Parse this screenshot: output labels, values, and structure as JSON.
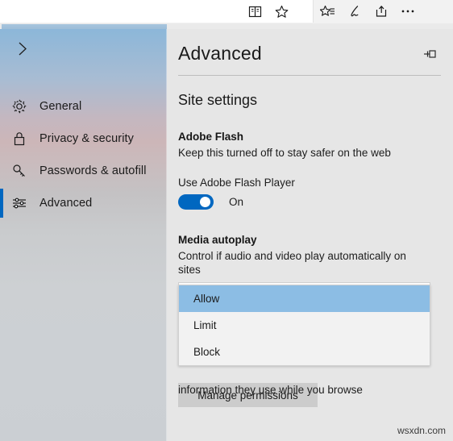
{
  "browser_chrome": {
    "icons": [
      {
        "name": "reading-view-icon",
        "glyph": "book"
      },
      {
        "name": "add-favorite-icon",
        "glyph": "star"
      },
      {
        "name": "hub-favorites-icon",
        "glyph": "star-list"
      },
      {
        "name": "web-note-icon",
        "glyph": "pen"
      },
      {
        "name": "share-icon",
        "glyph": "share"
      },
      {
        "name": "more-icon",
        "glyph": "ellipsis"
      }
    ]
  },
  "sidebar": {
    "back_icon": "chevron-right-icon",
    "items": [
      {
        "label": "General",
        "icon": "gear-icon",
        "selected": false
      },
      {
        "label": "Privacy & security",
        "icon": "lock-icon",
        "selected": false
      },
      {
        "label": "Passwords & autofill",
        "icon": "key-icon",
        "selected": false
      },
      {
        "label": "Advanced",
        "icon": "sliders-icon",
        "selected": true
      }
    ]
  },
  "pane": {
    "title": "Advanced",
    "pin_icon": "pin-icon",
    "section_title": "Site settings",
    "flash": {
      "heading": "Adobe Flash",
      "description": "Keep this turned off to stay safer on the web",
      "toggle_label": "Use Adobe Flash Player",
      "toggle_state": "On"
    },
    "media_autoplay": {
      "heading": "Media autoplay",
      "description": "Control if audio and video play automatically on sites",
      "selected_value": "Allow",
      "options": [
        "Allow",
        "Limit",
        "Block"
      ]
    },
    "obscured_description": "information they use while you browse",
    "manage_button": "Manage permissions"
  },
  "watermark": "wsxdn.com",
  "colors": {
    "accent_blue": "#0067c0",
    "selection_blue": "#8cbde4",
    "pane_background": "#e6e6e6",
    "button_gray": "#cccccc"
  }
}
